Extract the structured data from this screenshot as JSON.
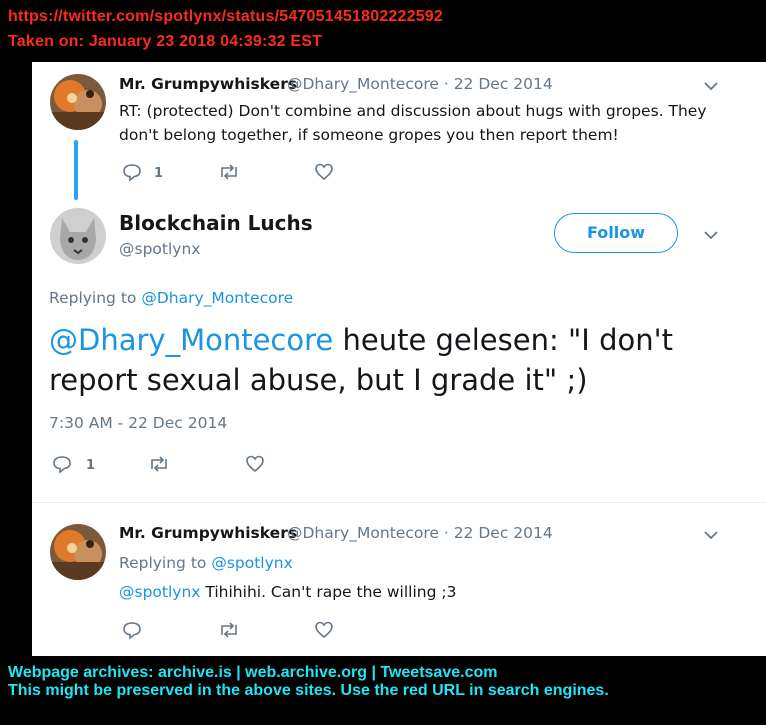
{
  "banner": {
    "url": "https://twitter.com/spotlynx/status/547051451802222592",
    "taken_on": "Taken on:  January 23 2018  04:39:32  EST"
  },
  "tweet1": {
    "name": "Mr. Grumpywhiskers",
    "meta": "@Dhary_Montecore · 22 Dec 2014",
    "text": "RT: (protected) Don't combine and discussion about hugs with gropes. They don't belong together,  if someone gropes you then report them!",
    "reply_count": "1"
  },
  "main_tweet": {
    "name": "Blockchain Luchs",
    "handle": "@spotlynx",
    "follow_label": "Follow",
    "replying_prefix": "Replying to ",
    "replying_to": "@Dhary_Montecore",
    "mention": "@Dhary_Montecore",
    "text": " heute gelesen: \"I don't report sexual abuse, but I grade it\" ;)",
    "timestamp": "7:30 AM - 22 Dec 2014",
    "reply_count": "1"
  },
  "tweet3": {
    "name": "Mr. Grumpywhiskers",
    "meta": "@Dhary_Montecore · 22 Dec 2014",
    "replying_prefix": "Replying to ",
    "replying_to": "@spotlynx",
    "mention": "@spotlynx",
    "text": " Tihihihi. Can't rape the willing ;3"
  },
  "footer": {
    "line1": "Webpage archives:  archive.is | web.archive.org | Tweetsave.com",
    "line2": "This might be preserved in the above sites. Use the red URL in search engines."
  },
  "colors": {
    "banner_red": "#ff2a1a",
    "footer_cyan": "#20e5f4",
    "twitter_blue": "#1b95e0",
    "muted": "#657786"
  },
  "icons": [
    "reply-icon",
    "retweet-icon",
    "like-icon",
    "chevron-down-icon"
  ]
}
